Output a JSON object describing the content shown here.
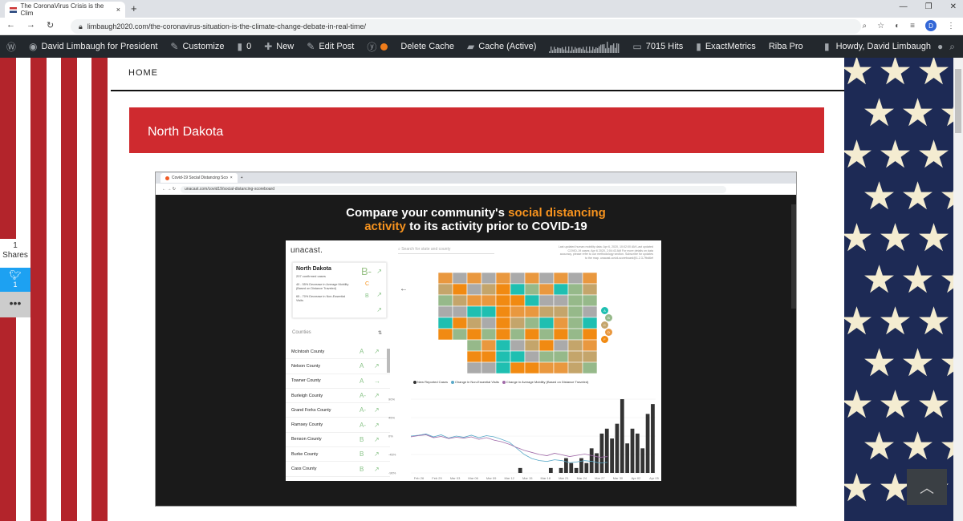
{
  "browser": {
    "tab_title": "The CoronaVirus Crisis is the Clim",
    "tab_close": "×",
    "new_tab": "+",
    "url": "limbaugh2020.com/the-coronavirus-situation-is-the-climate-change-debate-in-real-time/",
    "profile_initial": "D"
  },
  "adminbar": {
    "site": "David Limbaugh for President",
    "customize": "Customize",
    "comments": "0",
    "new": "New",
    "edit_post": "Edit Post",
    "delete_cache": "Delete Cache",
    "cache": "Cache (Active)",
    "hits": "7015 Hits",
    "exactmetrics": "ExactMetrics",
    "riba": "Riba Pro",
    "howdy": "Howdy, David Limbaugh"
  },
  "page": {
    "nav_home": "HOME",
    "section_title": "North Dakota"
  },
  "share": {
    "count": "1",
    "label": "Shares",
    "twitter_count": "1",
    "more": "•••"
  },
  "embed": {
    "tab_title": "Covid-19 Social Distancing Sco",
    "url": "unacast.com/covid19/social-distancing-scoreboard",
    "headline_1": "Compare your community's ",
    "headline_hl": "social distancing",
    "headline_2hl": "activity",
    "headline_2": " to its activity prior to COVID-19",
    "brand": "unacast.",
    "search_placeholder": "Search for state and county",
    "meta": "Last updated human mobility data: Apr 6, 2020, 10:02:00 AM Last updated COVID-19 cases: Apr 6 2020, 2:04:43 AM For more details on data accuracy, please refer to our methodology section. Subscribe for updates to the map. unacast-covid-scoreboard@1.2.3-7fbd6ef",
    "state": "North Dakota",
    "state_grade": "B-",
    "confirmed": "207 confirmed cases",
    "mobility_text": "40 - 55% Decrease in Average Mobility (Based on Distance Traveled)",
    "mobility_grade": "C",
    "visits_text": "65 - 70% Decrease in Non-Essential Visits",
    "visits_grade": "B",
    "counties_label": "Counties",
    "counties": [
      {
        "name": "McIntosh County",
        "grade": "A",
        "arrow": "↗"
      },
      {
        "name": "Nelson County",
        "grade": "A",
        "arrow": "↗"
      },
      {
        "name": "Towner County",
        "grade": "A",
        "arrow": "→"
      },
      {
        "name": "Burleigh County",
        "grade": "A-",
        "arrow": "↗"
      },
      {
        "name": "Grand Forks County",
        "grade": "A-",
        "arrow": "↗"
      },
      {
        "name": "Ramsey County",
        "grade": "A-",
        "arrow": "↗"
      },
      {
        "name": "Benson County",
        "grade": "B",
        "arrow": "↗"
      },
      {
        "name": "Burke County",
        "grade": "B",
        "arrow": "↗"
      },
      {
        "name": "Cass County",
        "grade": "B",
        "arrow": "↗"
      }
    ],
    "legend": [
      "New Reported Cases",
      "Change in Non-Essential Visits",
      "Change in Average Mobility (Based on Distance Traveled)"
    ],
    "legend_colors": [
      "#333333",
      "#5aa9c8",
      "#a06aa8"
    ],
    "map_scale": [
      "A",
      "B",
      "C",
      "D",
      "F"
    ]
  },
  "chart_data": {
    "type": "bar",
    "categories": [
      "Feb 26",
      "Feb 29",
      "Mar 03",
      "Mar 06",
      "Mar 09",
      "Mar 12",
      "Mar 15",
      "Mar 18",
      "Mar 21",
      "Mar 24",
      "Mar 27",
      "Mar 30",
      "Apr 02",
      "Apr 05"
    ],
    "y_ticks": [
      "90%",
      "45%",
      "0%",
      "-45%",
      "-90%"
    ],
    "series": [
      {
        "name": "New Reported Cases",
        "values": [
          0,
          0,
          0,
          0,
          0,
          0,
          0,
          0,
          0,
          0,
          0,
          0,
          0,
          0,
          0,
          0,
          0,
          0,
          0,
          0,
          0,
          1,
          0,
          0,
          0,
          0,
          0,
          1,
          0,
          1,
          3,
          2,
          1,
          3,
          2,
          5,
          4,
          8,
          9,
          7,
          10,
          15,
          6,
          9,
          8,
          5,
          12,
          14
        ]
      },
      {
        "name": "Change in Non-Essential Visits",
        "values": [
          0,
          2,
          5,
          -2,
          3,
          -5,
          0,
          -3,
          2,
          -4,
          1,
          -2,
          -8,
          -15,
          -30,
          -45,
          -55,
          -60,
          -62,
          -58,
          -60,
          -65,
          -63,
          -60,
          -62,
          -66,
          -64
        ]
      },
      {
        "name": "Change in Average Mobility (Based on Distance Traveled)",
        "values": [
          -2,
          1,
          3,
          -4,
          -1,
          -6,
          -3,
          -5,
          -2,
          -8,
          -4,
          -10,
          -14,
          -20,
          -28,
          -35,
          -40,
          -45,
          -48,
          -42,
          -46,
          -50,
          -47,
          -44,
          -48,
          -52,
          -50
        ]
      }
    ]
  }
}
